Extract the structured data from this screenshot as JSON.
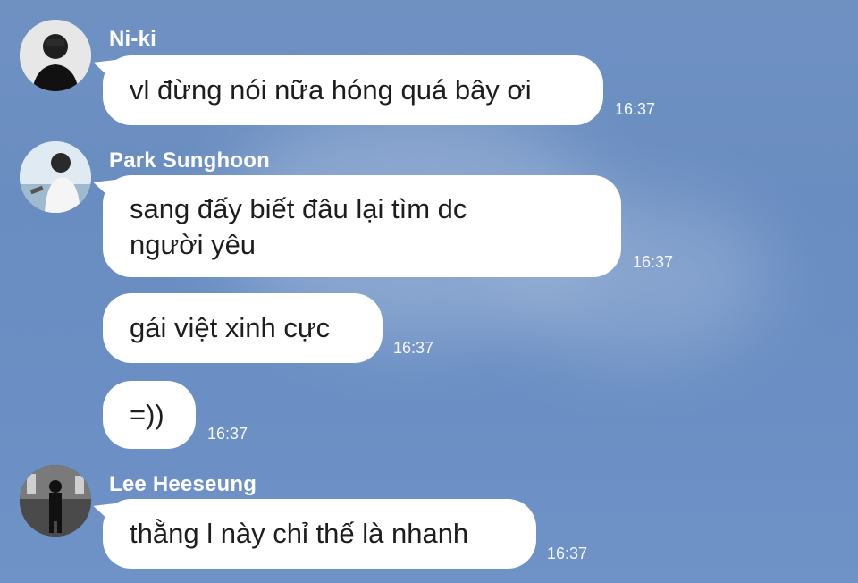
{
  "messages": [
    {
      "sender": "Ni-ki",
      "text": "vl đừng nói nữa hóng quá bây ơi",
      "time": "16:37",
      "avatar": "avatar-photo"
    },
    {
      "sender": "Park Sunghoon",
      "text": "sang đấy biết đâu lại tìm dc người yêu",
      "text_line1": "sang đấy biết đâu lại tìm dc",
      "text_line2": "người yêu",
      "time": "16:37",
      "avatar": "avatar-photo"
    },
    {
      "text": "gái việt xinh cực",
      "time": "16:37"
    },
    {
      "text": "=))",
      "time": "16:37"
    },
    {
      "sender": "Lee Heeseung",
      "text": "thằng l này chỉ thế là nhanh",
      "time": "16:37",
      "avatar": "avatar-photo"
    }
  ]
}
